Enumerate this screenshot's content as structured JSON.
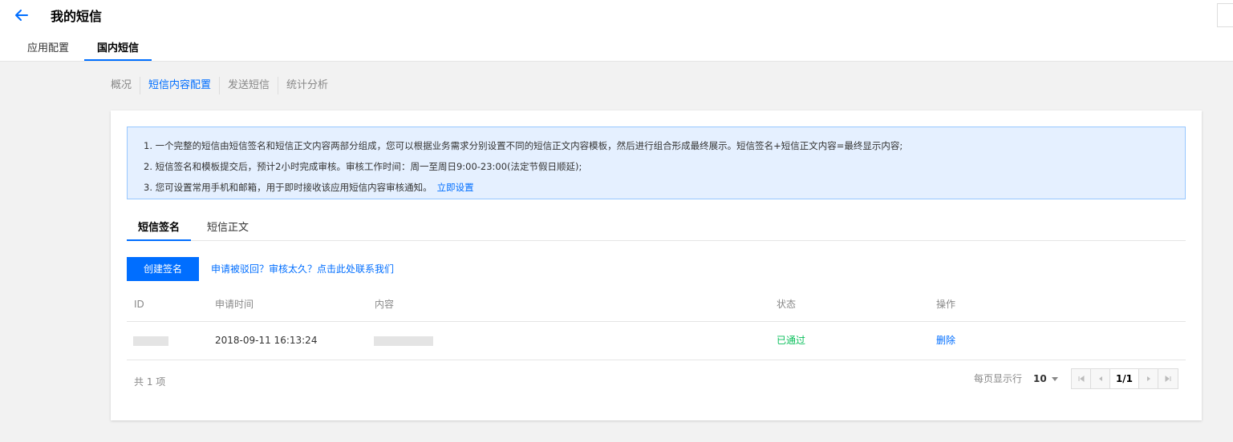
{
  "header": {
    "title": "我的短信",
    "tabs": [
      {
        "label": "应用配置",
        "active": false
      },
      {
        "label": "国内短信",
        "active": true
      }
    ]
  },
  "sub_nav": [
    {
      "label": "概况",
      "active": false
    },
    {
      "label": "短信内容配置",
      "active": true
    },
    {
      "label": "发送短信",
      "active": false
    },
    {
      "label": "统计分析",
      "active": false
    }
  ],
  "notice": {
    "lines": [
      "1. 一个完整的短信由短信签名和短信正文内容两部分组成，您可以根据业务需求分别设置不同的短信正文内容模板，然后进行组合形成最终展示。短信签名+短信正文内容=最终显示内容;",
      "2. 短信签名和模板提交后，预计2小时完成审核。审核工作时间：周一至周日9:00-23:00(法定节假日顺延);",
      "3. 您可设置常用手机和邮箱，用于即时接收该应用短信内容审核通知。"
    ],
    "link": "立即设置"
  },
  "content_tabs": [
    {
      "label": "短信签名",
      "active": true
    },
    {
      "label": "短信正文",
      "active": false
    }
  ],
  "toolbar": {
    "create_label": "创建签名",
    "help_link": "申请被驳回？审核太久？点击此处联系我们"
  },
  "table": {
    "columns": [
      "ID",
      "申请时间",
      "内容",
      "状态",
      "操作"
    ],
    "rows": [
      {
        "time": "2018-09-11 16:13:24",
        "status": "已通过",
        "action": "删除"
      }
    ]
  },
  "pagination": {
    "total": "共 1 项",
    "per_page_label": "每页显示行",
    "per_page": "10",
    "page": "1/1"
  },
  "colors": {
    "accent": "#006eff",
    "success": "#0abf5b",
    "notice_bg": "#e5f0ff",
    "notice_border": "#97c7ff"
  }
}
